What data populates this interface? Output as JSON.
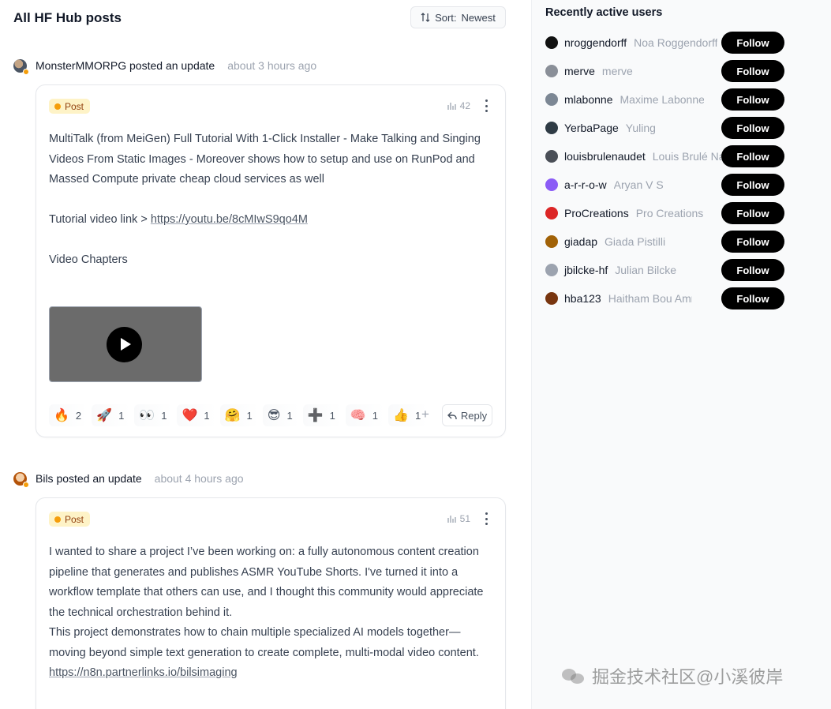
{
  "feed": {
    "title": "All HF Hub posts",
    "sort_label": "Sort:",
    "sort_value": "Newest"
  },
  "posts": [
    {
      "author": "MonsterMMORPG posted an update",
      "time": "about 3 hours ago",
      "badge": "Post",
      "views": "42",
      "paragraphs": [
        "MultiTalk (from MeiGen) Full Tutorial With 1-Click Installer - Make Talking and Singing Videos From Static Images - Moreover shows how to setup and use on RunPod and Massed Compute private cheap cloud services as well",
        "",
        "Tutorial video link > ",
        "",
        "Video Chapters"
      ],
      "link": "https://youtu.be/8cMIwS9qo4M",
      "reactions": [
        {
          "emoji": "🔥",
          "count": "2"
        },
        {
          "emoji": "🚀",
          "count": "1"
        },
        {
          "emoji": "👀",
          "count": "1"
        },
        {
          "emoji": "❤️",
          "count": "1"
        },
        {
          "emoji": "🤗",
          "count": "1"
        },
        {
          "emoji": "😎",
          "count": "1"
        },
        {
          "emoji": "➕",
          "count": "1"
        },
        {
          "emoji": "🧠",
          "count": "1"
        },
        {
          "emoji": "👍",
          "count": "1"
        }
      ],
      "reply_label": "Reply"
    },
    {
      "author": "Bils posted an update",
      "time": "about 4 hours ago",
      "badge": "Post",
      "views": "51",
      "paragraphs": [
        "I wanted to share a project I’ve been working on: a fully autonomous content creation pipeline that generates and publishes ASMR YouTube Shorts. I've turned it into a workflow template that others can use, and I thought this community would appreciate the technical orchestration behind it.",
        "This project demonstrates how to chain multiple specialized AI models together—moving beyond simple text generation to create complete, multi-modal video content."
      ],
      "link": "https://n8n.partnerlinks.io/bilsimaging"
    }
  ],
  "sidebar": {
    "title": "Recently active users",
    "follow_label": "Follow",
    "users": [
      {
        "handle": "nroggendorff",
        "name": "Noa Roggendorff",
        "color": "#111111"
      },
      {
        "handle": "merve",
        "name": "merve",
        "color": "#8a8f98"
      },
      {
        "handle": "mlabonne",
        "name": "Maxime Labonne",
        "color": "#7c8794"
      },
      {
        "handle": "YerbaPage",
        "name": "Yuling",
        "color": "#2f3b45"
      },
      {
        "handle": "louisbrulenaudet",
        "name": "Louis Brulé Naudet",
        "color": "#4a4f57"
      },
      {
        "handle": "a-r-r-o-w",
        "name": "Aryan V S",
        "color": "#8b5cf6"
      },
      {
        "handle": "ProCreations",
        "name": "Pro Creations",
        "color": "#dc2626"
      },
      {
        "handle": "giadap",
        "name": "Giada Pistilli",
        "color": "#a16207"
      },
      {
        "handle": "jbilcke-hf",
        "name": "Julian Bilcke",
        "color": "#9ca3af"
      },
      {
        "handle": "hba123",
        "name": "Haitham Bou Ammar",
        "color": "#78350f"
      }
    ]
  },
  "watermark": "掘金技术社区@小溪彼岸"
}
